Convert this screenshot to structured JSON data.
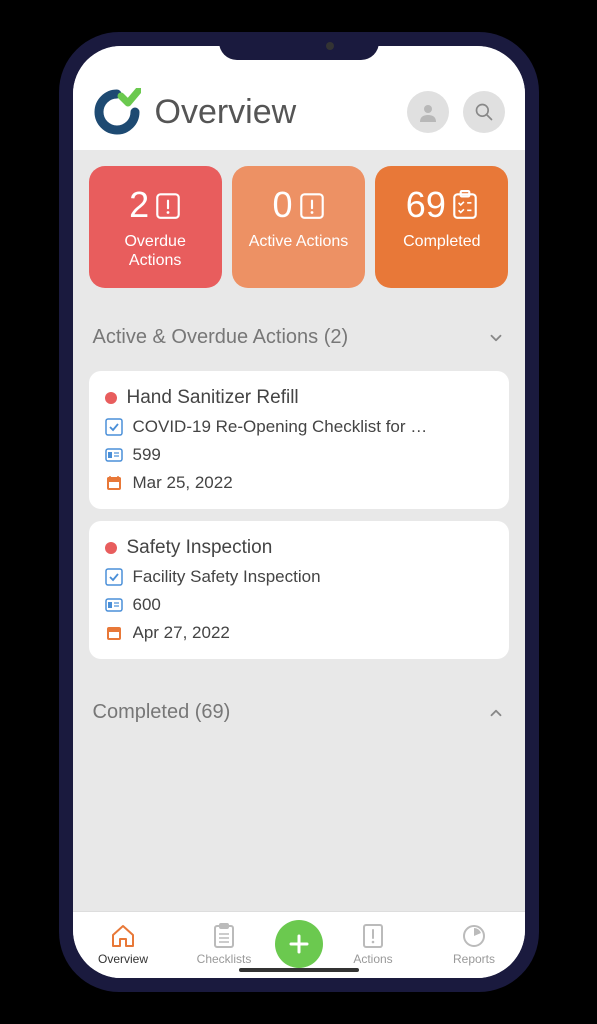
{
  "header": {
    "title": "Overview"
  },
  "stats": {
    "overdue": {
      "count": "2",
      "label": "Overdue Actions"
    },
    "active": {
      "count": "0",
      "label": "Active Actions"
    },
    "completed": {
      "count": "69",
      "label": "Completed"
    }
  },
  "sections": {
    "active_overdue": {
      "title": "Active & Overdue Actions (2)"
    },
    "completed": {
      "title": "Completed (69)"
    }
  },
  "actions": [
    {
      "title": "Hand Sanitizer Refill",
      "checklist": "COVID-19 Re-Opening Checklist for …",
      "id": "599",
      "date": "Mar 25, 2022"
    },
    {
      "title": "Safety Inspection",
      "checklist": "Facility Safety Inspection",
      "id": "600",
      "date": "Apr 27, 2022"
    }
  ],
  "nav": {
    "overview": "Overview",
    "checklists": "Checklists",
    "actions": "Actions",
    "reports": "Reports"
  }
}
